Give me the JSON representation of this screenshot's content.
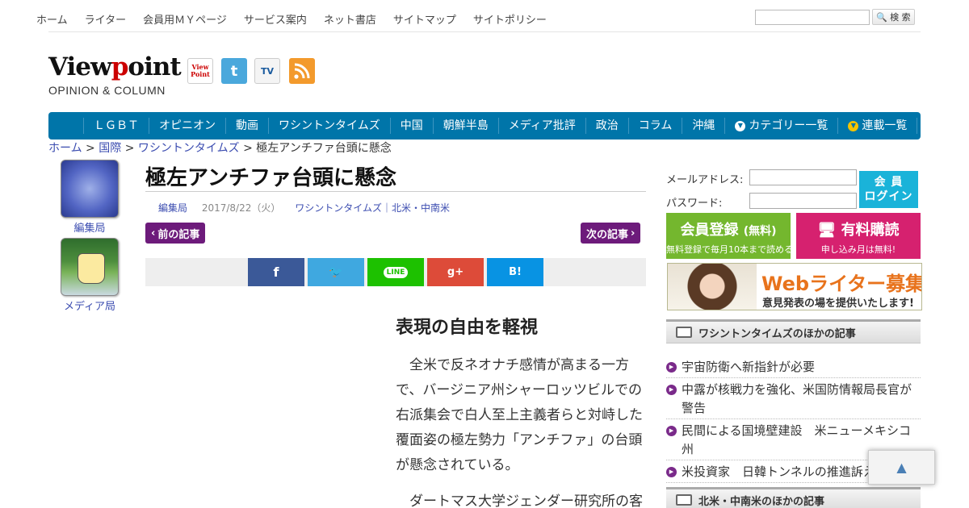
{
  "topnav": {
    "items": [
      "ホーム",
      "ライター",
      "会員用ＭＹページ",
      "サービス案内",
      "ネット書店",
      "サイトマップ",
      "サイトポリシー"
    ],
    "search_placeholder": "",
    "search_label": "検 索"
  },
  "logo": {
    "main_a": "View",
    "main_p": "p",
    "main_b": "oint",
    "sub": "OPINION & COLUMN"
  },
  "social": {
    "viewpoint_icon": "View Point",
    "twitter_icon": "t",
    "tv_icon": "TV",
    "rss_icon": "rss"
  },
  "mainnav": {
    "items": [
      "ＬＧＢＴ",
      "オピニオン",
      "動画",
      "ワシントンタイムズ",
      "中国",
      "朝鮮半島",
      "メディア批評",
      "政治",
      "コラム",
      "沖縄"
    ],
    "category_list": "カテゴリー一覧",
    "series_list": "連載一覧"
  },
  "breadcrumb": {
    "home": "ホーム",
    "sep": ">",
    "international": "国際",
    "washington": "ワシントンタイムズ",
    "current": "極左アンチファ台頭に懸念"
  },
  "authors": [
    {
      "name": "編集局"
    },
    {
      "name": "メディア局"
    }
  ],
  "article": {
    "title": "極左アンチファ台頭に懸念",
    "author": "編集局",
    "date": "2017/8/22（火）",
    "categories": "ワシントンタイムズ｜北米・中南米",
    "prev_label": "前の記事",
    "next_label": "次の記事",
    "subhead": "表現の自由を軽視",
    "paragraphs": [
      "全米で反ネオナチ感情が高まる一方で、バージニア州シャーロッツビルでの右派集会で白人至上主義者らと対峙した覆面姿の極左勢力「アンチファ」の台頭が懸念されている。",
      "ダートマス大学ジェンダー研究所の客"
    ]
  },
  "share": {
    "facebook": "f",
    "twitter": "🐦",
    "line": "LINE",
    "googleplus": "g+",
    "hatena": "B!"
  },
  "login": {
    "email_label": "メールアドレス:",
    "password_label": "パスワード:",
    "button_line1": "会 員",
    "button_line2": "ログイン"
  },
  "promo": {
    "register_big": "会員登録",
    "register_free": "(無料)",
    "register_small": "無料登録で毎月10本まで読める",
    "paid_big": "有料購読",
    "paid_small": "申し込み月は無料!"
  },
  "banner": {
    "title": "Webライター募集",
    "subtitle": "意見発表の場を提供いたします!"
  },
  "sections": {
    "washington_other": "ワシントンタイムズのほかの記事",
    "americas_other": "北米・中南米のほかの記事"
  },
  "related": [
    "宇宙防衛へ新指針が必要",
    "中露が核戦力を強化、米国防情報局長官が警告",
    "民間による国境壁建設　米ニューメキシコ州",
    "米投資家　日韓トンネルの推進訴え"
  ],
  "totop": "▲",
  "colors": {
    "nav": "#0075a9",
    "purple": "#6d1b7b",
    "link": "#3b4cb0",
    "green": "#74b72e",
    "pink": "#d6216f",
    "cyan": "#1ab3d9"
  }
}
